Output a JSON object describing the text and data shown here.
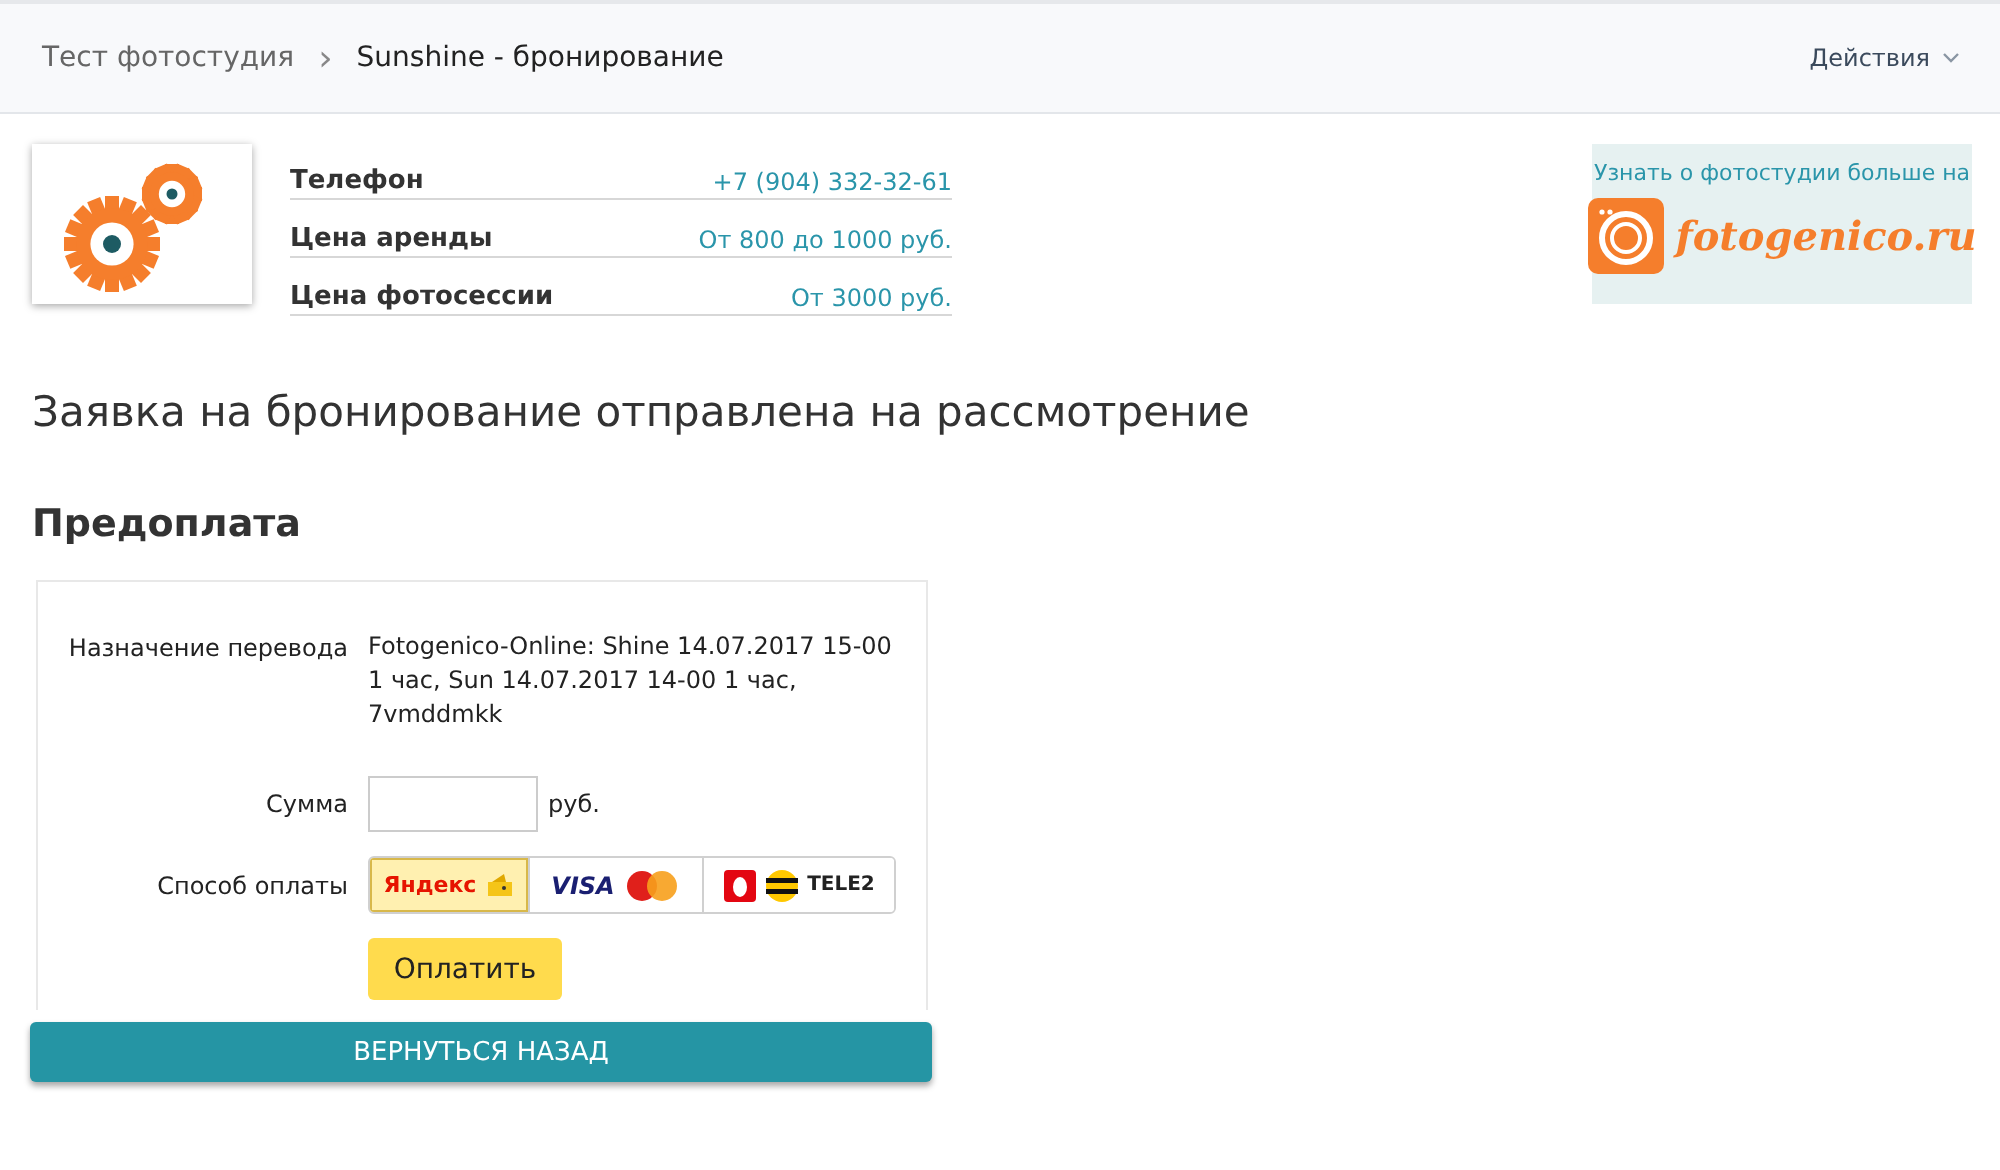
{
  "breadcrumb": {
    "parent": "Тест фотостудия",
    "separator": "›",
    "current": "Sunshine - бронирование"
  },
  "actions": {
    "label": "Действия"
  },
  "info": [
    {
      "label": "Телефон",
      "value": "+7 (904) 332-32-61"
    },
    {
      "label": "Цена аренды",
      "value": "От 800 до 1000 руб."
    },
    {
      "label": "Цена фотосессии",
      "value": "От 3000 руб."
    }
  ],
  "promo": {
    "text": "Узнать о фотостудии больше на",
    "brand": "fotogenico.ru"
  },
  "status_message": "Заявка на бронирование отправлена на рассмотрение",
  "section_title": "Предоплата",
  "form": {
    "purpose_label": "Назначение перевода",
    "purpose": "Fotogenico-Online: Shine 14.07.2017 15-00 1 час, Sun 14.07.2017 14-00 1 час, 7vmddmkk",
    "amount_label": "Сумма",
    "currency": "руб.",
    "method_label": "Способ оплаты",
    "methods": [
      {
        "kind": "yandex",
        "labels": [
          "Яндекс"
        ],
        "selected": true
      },
      {
        "kind": "cards",
        "labels": [
          "VISA"
        ],
        "selected": false
      },
      {
        "kind": "mobile",
        "labels": [
          "TELE2"
        ],
        "selected": false
      }
    ],
    "pay_button": "Оплатить"
  },
  "back_button": "ВЕРНУТЬСЯ НАЗАД"
}
